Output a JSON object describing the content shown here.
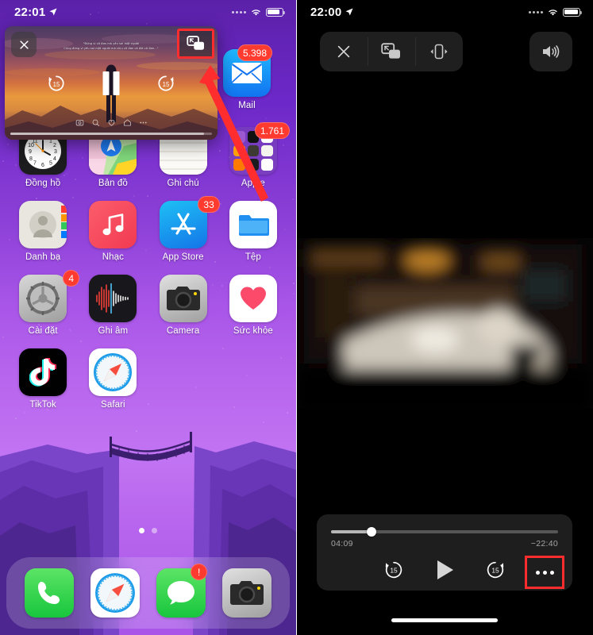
{
  "left_phone": {
    "status_bar": {
      "time": "22:01",
      "location_icon": "location-arrow-icon",
      "wifi_icon": "wifi-icon",
      "battery_icon": "battery-icon"
    },
    "pip_window": {
      "close_icon": "close-x-icon",
      "pip_toggle_icon": "picture-in-picture-icon",
      "caption_line1": "\"Đừng vì cô đơn mà yêu sai một người",
      "caption_line2": "Cũng đừng vì yêu sai một người mà chịu cô đơn cả đời cô đơn...\"",
      "skip_back_label": "15",
      "skip_forward_label": "15",
      "pause_icon": "pause-icon",
      "social_icons": [
        "camera-icon",
        "search-icon",
        "heart-icon",
        "home-icon",
        "more-icon"
      ],
      "highlight_color": "#ff2d2d"
    },
    "apps": [
      {
        "name": "Đồng hồ",
        "icon": "clock-icon",
        "badge": null
      },
      {
        "name": "Bản đồ",
        "icon": "maps-icon",
        "badge": null
      },
      {
        "name": "Ghi chú",
        "icon": "notes-icon",
        "badge": null
      },
      {
        "name": "Apple",
        "icon": "folder-apple-icon",
        "badge": "1.761"
      },
      {
        "name": "Danh bạ",
        "icon": "contacts-icon",
        "badge": null
      },
      {
        "name": "Nhạc",
        "icon": "music-icon",
        "badge": null
      },
      {
        "name": "App Store",
        "icon": "app-store-icon",
        "badge": "33"
      },
      {
        "name": "Tệp",
        "icon": "files-icon",
        "badge": null
      },
      {
        "name": "Cài đặt",
        "icon": "settings-gear-icon",
        "badge": "4"
      },
      {
        "name": "Ghi âm",
        "icon": "voice-memos-icon",
        "badge": null
      },
      {
        "name": "Camera",
        "icon": "camera-icon",
        "badge": null
      },
      {
        "name": "Sức khỏe",
        "icon": "health-heart-icon",
        "badge": null
      },
      {
        "name": "TikTok",
        "icon": "tiktok-icon",
        "badge": null
      },
      {
        "name": "Safari",
        "icon": "safari-compass-icon",
        "badge": null
      }
    ],
    "mail_app": {
      "name": "Mail",
      "icon": "mail-envelope-icon",
      "badge": "5.398"
    },
    "page_dots": {
      "count": 2,
      "active_index": 0
    },
    "dock": [
      {
        "name": "phone-app",
        "icon": "phone-handset-icon",
        "badge": null
      },
      {
        "name": "safari-app",
        "icon": "safari-compass-icon",
        "badge": null
      },
      {
        "name": "messages-app",
        "icon": "messages-bubble-icon",
        "badge": "!"
      },
      {
        "name": "camera-app",
        "icon": "camera-icon",
        "badge": null
      }
    ]
  },
  "right_phone": {
    "status_bar": {
      "time": "22:00",
      "location_icon": "location-arrow-icon",
      "wifi_icon": "wifi-icon",
      "battery_icon": "battery-icon"
    },
    "toolbar": {
      "close_icon": "close-x-icon",
      "pip_icon": "picture-in-picture-icon",
      "rotate_icon": "screen-rotate-icon"
    },
    "speaker_icon": "speaker-volume-icon",
    "player": {
      "current_time": "04:09",
      "remaining_time": "−22:40",
      "progress_percent": 18,
      "skip_back_label": "15",
      "skip_forward_label": "15",
      "play_icon": "play-triangle-icon",
      "more_icon": "more-ellipsis-icon",
      "highlight_color": "#ff2d2d"
    },
    "home_indicator": "home-bar"
  }
}
